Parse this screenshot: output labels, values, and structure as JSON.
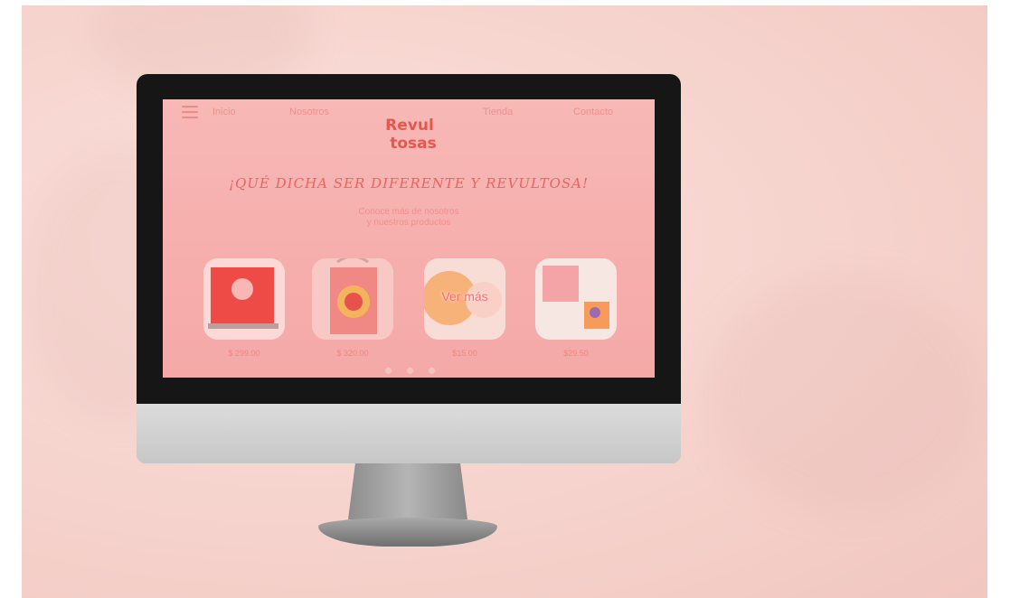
{
  "nav": {
    "links": [
      "Inicio",
      "Nosotros",
      "Tienda",
      "Contacto"
    ]
  },
  "brand": {
    "logo_line1": "Revul",
    "logo_line2": "tosas"
  },
  "hero": {
    "headline": "¡QUÉ DICHA SER DIFERENTE Y REVULTOSA!",
    "subtext_line1": "Conoce más de nosotros",
    "subtext_line2": "y nuestros productos"
  },
  "products": [
    {
      "price": "$ 299.00",
      "image": "red-notebook-product"
    },
    {
      "price": "$ 320.00",
      "image": "tote-bag-product"
    },
    {
      "price": "$15.00",
      "image": "sticker-product",
      "overlay": "Ver más"
    },
    {
      "price": "$29.50",
      "image": "stationery-product"
    }
  ],
  "carousel": {
    "dots": 3
  },
  "colors": {
    "background": "#f6d3cd",
    "screen": "#f7b8b6",
    "accent": "#e8655f",
    "text_soft": "#f08f8b"
  }
}
